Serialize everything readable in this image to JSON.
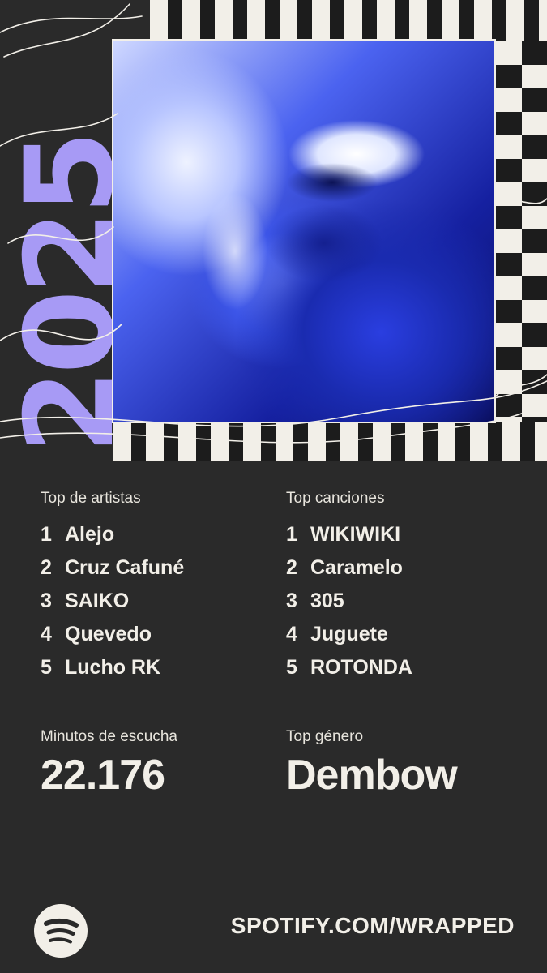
{
  "banner": {
    "year_text": "2025",
    "photo_icon": "album-art-icon"
  },
  "top_artists": {
    "heading": "Top de artistas",
    "items": [
      {
        "rank": "1",
        "name": "Alejo"
      },
      {
        "rank": "2",
        "name": "Cruz Cafuné"
      },
      {
        "rank": "3",
        "name": "SAIKO"
      },
      {
        "rank": "4",
        "name": "Quevedo"
      },
      {
        "rank": "5",
        "name": "Lucho RK"
      }
    ]
  },
  "top_songs": {
    "heading": "Top canciones",
    "items": [
      {
        "rank": "1",
        "name": "WIKIWIKI"
      },
      {
        "rank": "2",
        "name": "Caramelo"
      },
      {
        "rank": "3",
        "name": "305"
      },
      {
        "rank": "4",
        "name": "Juguete"
      },
      {
        "rank": "5",
        "name": "ROTONDA"
      }
    ]
  },
  "minutes": {
    "label": "Minutos de escucha",
    "value": "22.176"
  },
  "genre": {
    "label": "Top género",
    "value": "Dembow"
  },
  "footer": {
    "logo_icon": "spotify-logo-icon",
    "url": "SPOTIFY.COM/WRAPPED"
  },
  "colors": {
    "background": "#2a2a2a",
    "text": "#f2efe8",
    "accent_purple": "#a79af5"
  }
}
